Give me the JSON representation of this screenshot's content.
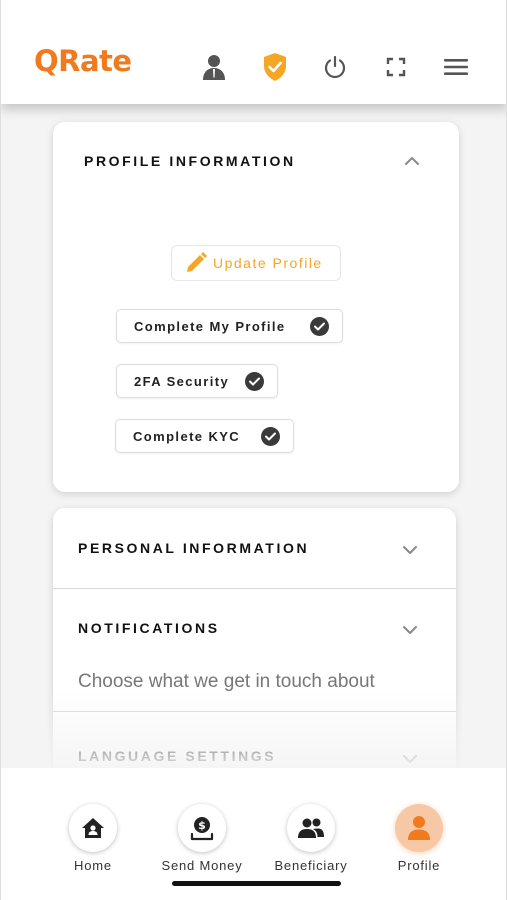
{
  "app": {
    "logo_text": "QRate",
    "brand_color": "#f07a1d",
    "accent_color": "#f4a624"
  },
  "header": {
    "icons": [
      "user-icon",
      "shield-check-icon",
      "power-icon",
      "fullscreen-icon",
      "hamburger-menu-icon"
    ]
  },
  "profile_card": {
    "title": "PROFILE INFORMATION",
    "update_button": "Update Profile",
    "chips": [
      {
        "label": "Complete My Profile",
        "completed": true
      },
      {
        "label": "2FA Security",
        "completed": true
      },
      {
        "label": "Complete KYC",
        "completed": true
      }
    ]
  },
  "sections": [
    {
      "title": "PERSONAL INFORMATION",
      "subtitle": ""
    },
    {
      "title": "NOTIFICATIONS",
      "subtitle": "Choose what we get in touch about"
    },
    {
      "title": "LANGUAGE SETTINGS",
      "subtitle": ""
    }
  ],
  "bottom_nav": [
    {
      "label": "Home",
      "icon": "home-icon",
      "active": false
    },
    {
      "label": "Send Money",
      "icon": "send-money-icon",
      "active": false
    },
    {
      "label": "Beneficiary",
      "icon": "beneficiary-icon",
      "active": false
    },
    {
      "label": "Profile",
      "icon": "profile-icon",
      "active": true
    }
  ]
}
